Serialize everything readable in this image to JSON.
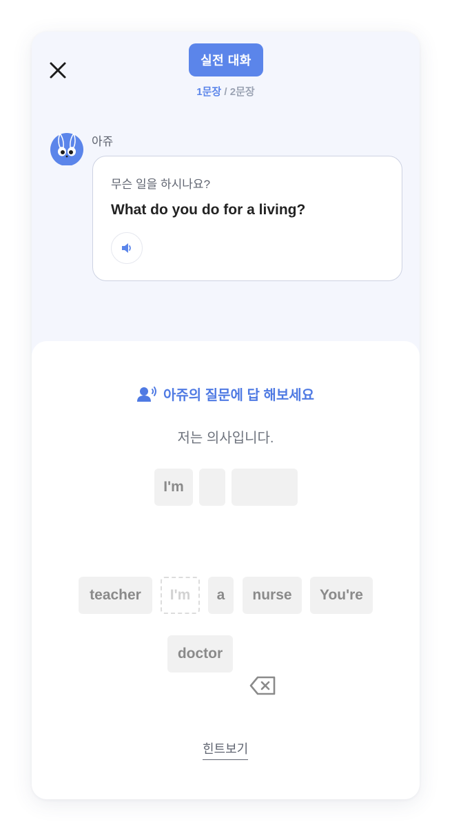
{
  "header": {
    "close_icon": "close-icon",
    "mode_label": "실전 대화",
    "progress_current": "1문장",
    "progress_separator": " / ",
    "progress_total": "2문장"
  },
  "conversation": {
    "speaker_name": "아쥬",
    "avatar_icon": "bunny-avatar-icon",
    "question_ko": "무슨 일을 하시나요?",
    "question_en": "What do you do for a living?",
    "play_icon": "speaker-icon"
  },
  "exercise": {
    "instruction_icon": "speaking-person-icon",
    "instruction": "아쥬의 질문에 답 해보세요",
    "translation": "저는 의사입니다.",
    "answer_slots": [
      "I'm",
      "",
      ""
    ],
    "word_bank": [
      {
        "label": "teacher",
        "used": false
      },
      {
        "label": "I'm",
        "used": true
      },
      {
        "label": "a",
        "used": false
      },
      {
        "label": "nurse",
        "used": false
      },
      {
        "label": "You're",
        "used": false
      },
      {
        "label": "doctor",
        "used": false
      }
    ],
    "backspace_icon": "backspace-icon",
    "hint_label": "힌트보기"
  },
  "colors": {
    "accent": "#5b85ea",
    "card_background": "#f4f6fd",
    "tile_background": "#f1f1f1",
    "tile_text": "#8a8a8a"
  }
}
